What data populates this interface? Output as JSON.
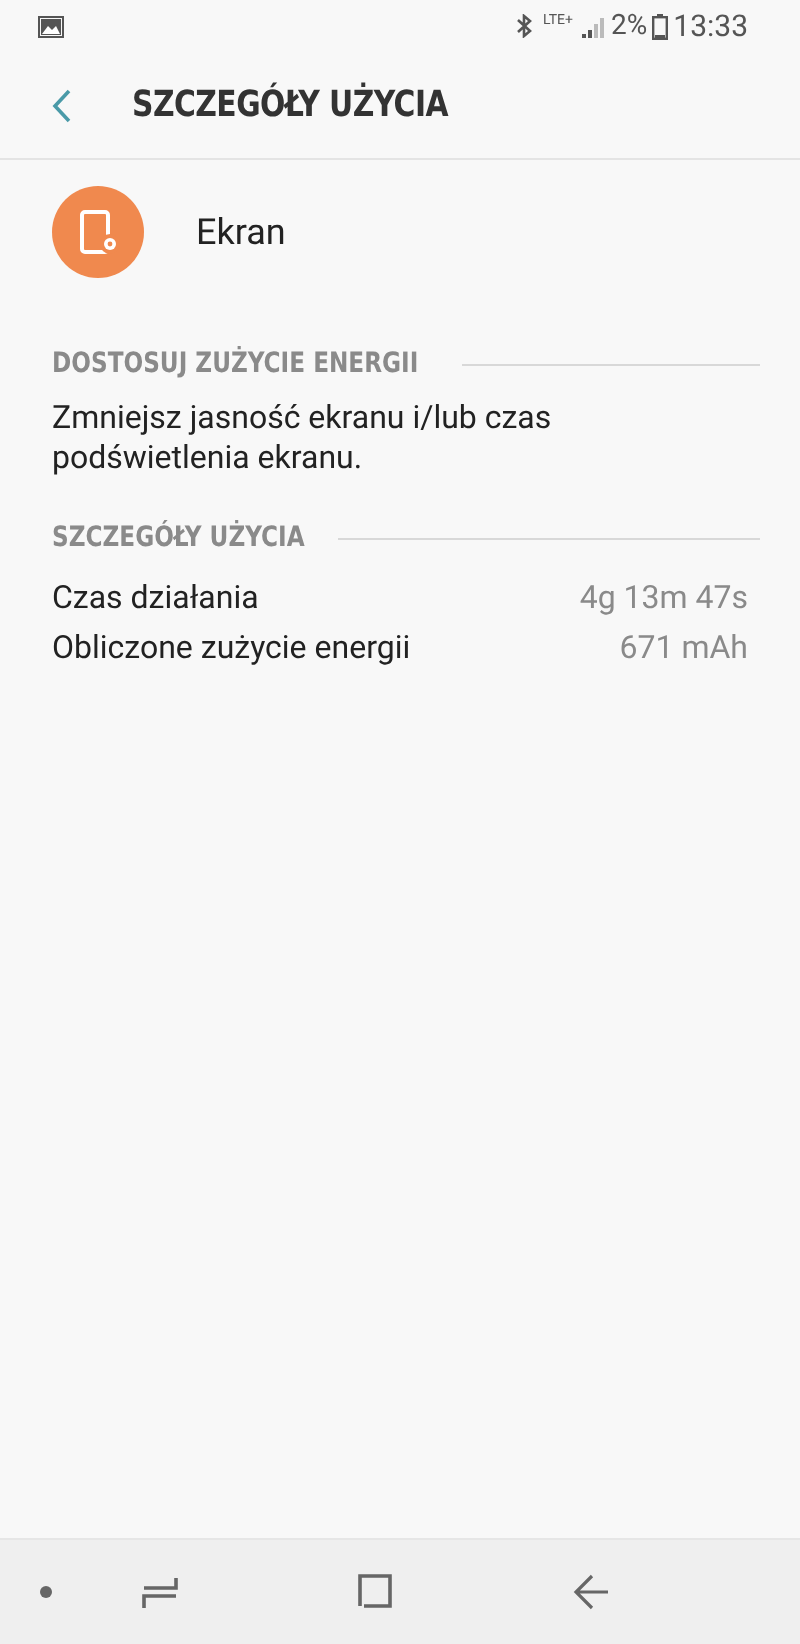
{
  "status_bar": {
    "network": "LTE+",
    "battery": "2%",
    "time": "13:33"
  },
  "header": {
    "title": "SZCZEGÓŁY UŻYCIA"
  },
  "app": {
    "name": "Ekran"
  },
  "sections": [
    {
      "title": "DOSTOSUJ ZUŻYCIE ENERGII",
      "kind": "text",
      "text": "Zmniejsz jasność ekranu i/lub czas podświetlenia ekranu."
    },
    {
      "title": "SZCZEGÓŁY UŻYCIA",
      "kind": "rows",
      "rows": [
        {
          "label": "Czas działania",
          "value": "4g 13m 47s"
        },
        {
          "label": "Obliczone zużycie energii",
          "value": "671 mAh"
        }
      ]
    }
  ]
}
